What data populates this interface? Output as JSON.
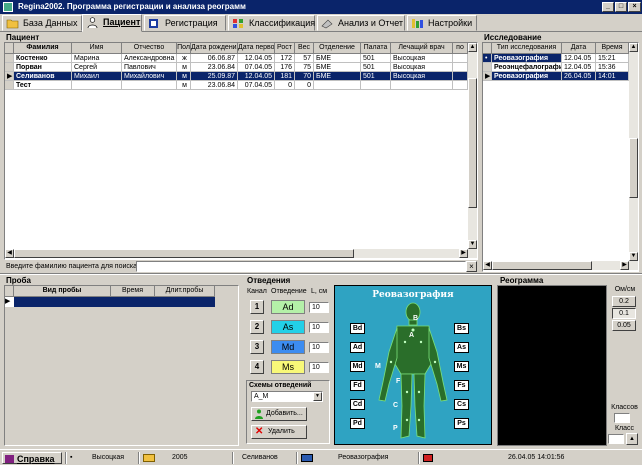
{
  "window": {
    "title": "Regina2002. Программа регистрации и анализа реограмм"
  },
  "tabs": [
    {
      "label": "База Данных",
      "icon": "database-icon"
    },
    {
      "label": "Пациент",
      "icon": "patient-icon"
    },
    {
      "label": "Регистрация",
      "icon": "registration-icon"
    },
    {
      "label": "Классификация",
      "icon": "classification-icon"
    },
    {
      "label": "Анализ и Отчет",
      "icon": "report-icon"
    },
    {
      "label": "Настройки",
      "icon": "settings-icon"
    }
  ],
  "patient_panel": {
    "title": "Пациент",
    "columns": [
      "Фамилия",
      "Имя",
      "Отчество",
      "Пол",
      "Дата рождения",
      "Дата первого ко",
      "Рост",
      "Вес",
      "Отделение",
      "Палата",
      "Лечащий врач",
      "по"
    ],
    "rows": [
      [
        "Костенко",
        "Марина",
        "Александровна",
        "ж",
        "06.06.87",
        "12.04.05",
        "172",
        "57",
        "БМЕ",
        "501",
        "Высоцкая",
        ""
      ],
      [
        "Порван",
        "Сергей",
        "Павлович",
        "м",
        "23.06.84",
        "07.04.05",
        "176",
        "75",
        "БМЕ",
        "501",
        "Высоцкая",
        ""
      ],
      [
        "Селиванов",
        "Михаил",
        "Михайлович",
        "м",
        "25.09.87",
        "12.04.05",
        "181",
        "70",
        "БМЕ",
        "501",
        "Высоцкая",
        ""
      ],
      [
        "Тест",
        "",
        "",
        "м",
        "23.06.84",
        "07.04.05",
        "0",
        "0",
        "",
        "",
        "",
        ""
      ]
    ],
    "selected_row": 2,
    "search_label": "Введите фамилию пациента для поиска"
  },
  "research_panel": {
    "title": "Исследование",
    "columns": [
      "Тип исследования",
      "Дата",
      "Время"
    ],
    "rows": [
      [
        "Реовазография",
        "12.04.05",
        "15:21"
      ],
      [
        "Реоэнцефалография",
        "12.04.05",
        "15:36"
      ],
      [
        "Реовазография",
        "26.04.05",
        "14:01"
      ]
    ],
    "selected_row": 2
  },
  "probe_panel": {
    "title": "Проба",
    "columns": [
      "Вид пробы",
      "Время",
      "Длит.пробы"
    ]
  },
  "leads_panel": {
    "title": "Отведения",
    "col_channel": "Канал",
    "col_lead": "Отведение",
    "col_l": "L, см",
    "channels": [
      {
        "num": "1",
        "lead": "Ad",
        "color": "#b4f0a8",
        "l": "10"
      },
      {
        "num": "2",
        "lead": "As",
        "color": "#22d0e8",
        "l": "10"
      },
      {
        "num": "3",
        "lead": "Md",
        "color": "#3c8cf0",
        "l": "10"
      },
      {
        "num": "4",
        "lead": "Ms",
        "color": "#f8f878",
        "l": "10"
      }
    ],
    "schemes_title": "Схемы отведений",
    "scheme_value": "A_M",
    "add_label": "Добавить...",
    "delete_label": "Удалить"
  },
  "figure": {
    "title": "Реовазография",
    "left_labels": [
      "Bd",
      "Ad",
      "Md",
      "Fd",
      "Cd",
      "Pd"
    ],
    "right_labels": [
      "Bs",
      "As",
      "Ms",
      "Fs",
      "Cs",
      "Ps"
    ],
    "body_letters": [
      "B",
      "A",
      "M",
      "F",
      "C",
      "P"
    ]
  },
  "reogram_panel": {
    "title": "Реограмма",
    "scale_label": "Ом/см",
    "scale_values": [
      "0.2",
      "0.1",
      "0.05"
    ],
    "selected_scale": "0.1",
    "classes_label": "Классов",
    "class_label": "Класс"
  },
  "status_bar": {
    "help_label": "Справка",
    "doctor": "Высоцкая",
    "year": "2005",
    "patient": "Селиванов",
    "study": "Реовазография",
    "datetime": "26.04.05  14:01:56"
  },
  "colors": {
    "selection": "#0a246a",
    "titlebar": "#0a246a",
    "figure_bg": "#2fa3c2",
    "face": "#d4d0c8"
  }
}
